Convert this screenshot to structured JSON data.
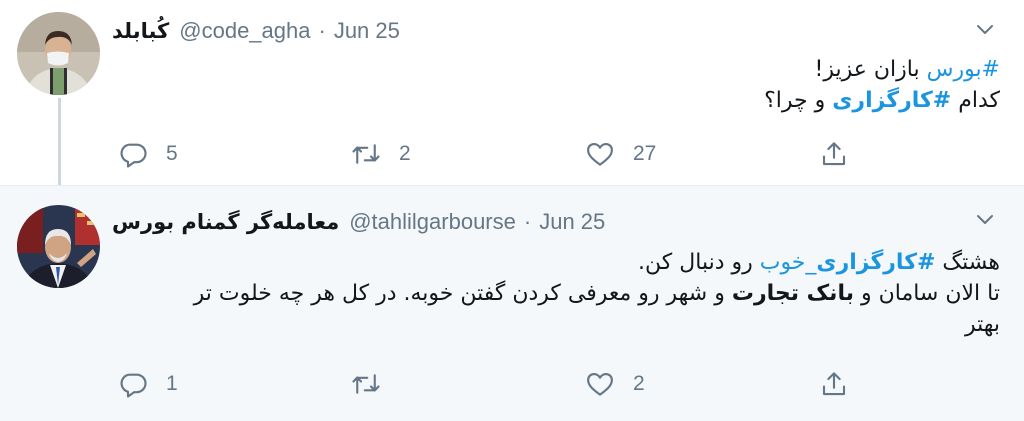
{
  "tweets": [
    {
      "display_name": "کُبابلد",
      "handle": "@code_agha",
      "separator": "·",
      "date": "Jun 25",
      "body": {
        "line1": {
          "hashtag": "#بورس",
          "text": " بازان عزیز!"
        },
        "line2": {
          "pre": "کدام ",
          "hashtag": "#کارگزاری",
          "post": " و چرا؟"
        }
      },
      "replies": "5",
      "retweets": "2",
      "likes": "27"
    },
    {
      "display_name": "معامله‌گر گمنام بورس",
      "handle": "@tahlilgarbourse",
      "separator": "·",
      "date": "Jun 25",
      "body": {
        "line1": {
          "pre": "هشتگ ",
          "hashtag": "#کارگزاری",
          "link": "_خوب",
          "post": " رو دنبال کن."
        },
        "line2": {
          "pre": "تا الان سامان و ",
          "bold": "بانک تجارت",
          "post": " و شهر رو معرفی کردن گفتن خوبه. در کل هر چه خلوت تر"
        },
        "line3": "بهتر"
      },
      "replies": "1",
      "retweets": "",
      "likes": "2"
    }
  ],
  "colors": {
    "accent": "#1b95e0",
    "secondary_text": "#657786",
    "reply_background": "#f5f8fa",
    "thread_line": "#ccd6dd"
  },
  "icons": [
    "chevron-down-icon",
    "reply-icon",
    "retweet-icon",
    "like-icon",
    "share-icon"
  ]
}
